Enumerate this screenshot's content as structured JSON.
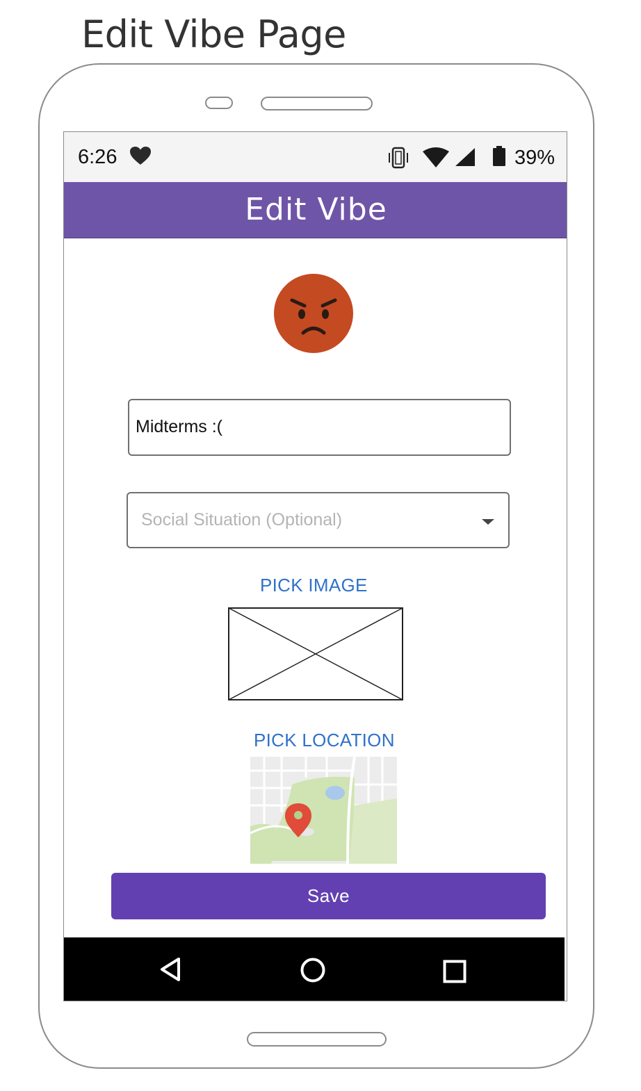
{
  "page_heading": "Edit Vibe Page",
  "status_bar": {
    "time": "6:26",
    "battery_percent": "39%",
    "icons": [
      "heart-icon",
      "vibrate-icon",
      "wifi-icon",
      "cell-signal-icon",
      "battery-icon"
    ],
    "battery_level": 0.39
  },
  "app_bar": {
    "title": "Edit Vibe",
    "color": "#6f55a8"
  },
  "mood": {
    "emoji": "angry-face-icon",
    "color": "#c44a22"
  },
  "form": {
    "title_value": "Midterms :(",
    "social_select": {
      "placeholder": "Social Situation (Optional)"
    },
    "pick_image_label": "PICK IMAGE",
    "pick_location_label": "PICK LOCATION",
    "save_label": "Save"
  },
  "colors": {
    "accent": "#6240b1",
    "link": "#2f72c8"
  },
  "nav_bar": {
    "icons": [
      "back-icon",
      "home-icon",
      "recents-icon"
    ]
  }
}
